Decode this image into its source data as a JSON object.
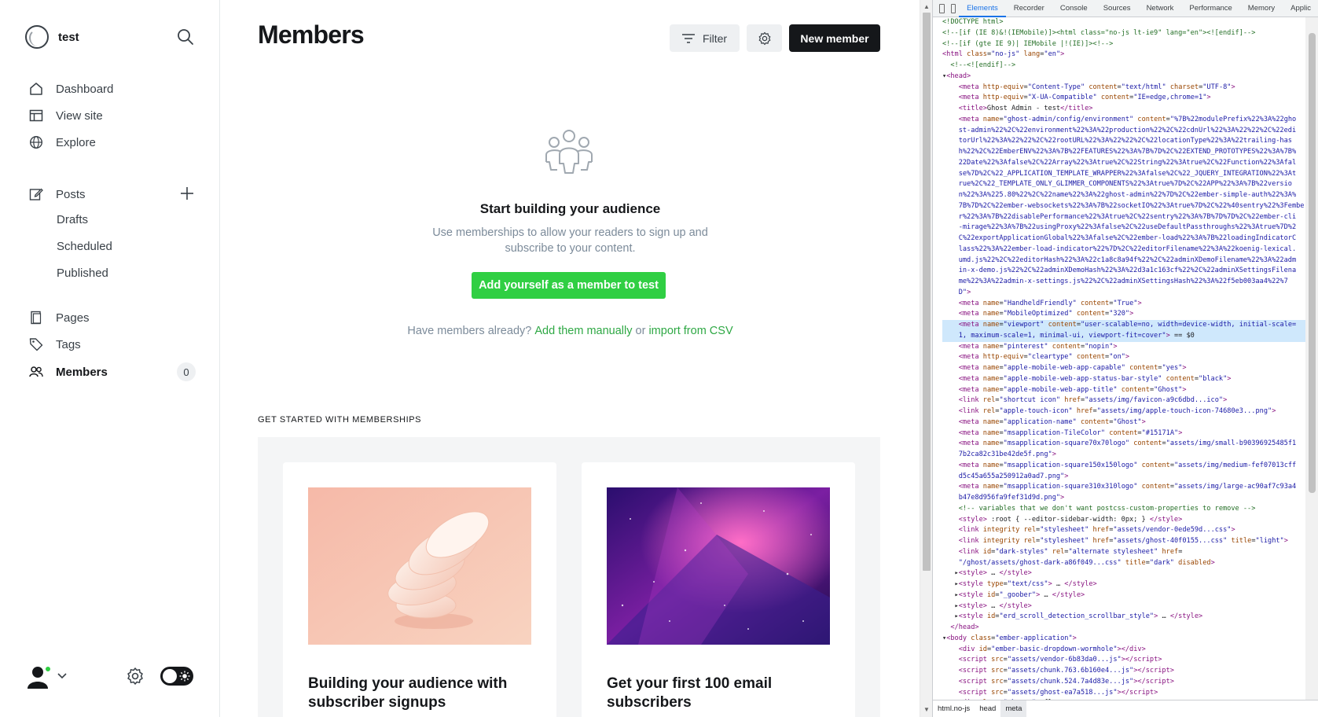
{
  "sidebar": {
    "site_title": "test",
    "nav": {
      "dashboard": "Dashboard",
      "view_site": "View site",
      "explore": "Explore",
      "posts": "Posts",
      "drafts": "Drafts",
      "scheduled": "Scheduled",
      "published": "Published",
      "pages": "Pages",
      "tags": "Tags",
      "members": "Members",
      "members_count": "0"
    }
  },
  "main": {
    "title": "Members",
    "filter_label": "Filter",
    "new_member_label": "New member",
    "empty_title": "Start building your audience",
    "empty_desc": "Use memberships to allow your readers to sign up and subscribe to your content.",
    "add_self_label": "Add yourself as a member to test",
    "have_members_prefix": "Have members already?",
    "add_manually": "Add them manually",
    "or_text": "or",
    "import_csv": "import from CSV",
    "section_label": "GET STARTED WITH MEMBERSHIPS",
    "cards": [
      {
        "title": "Building your audience with subscriber signups"
      },
      {
        "title": "Get your first 100 email subscribers"
      }
    ]
  },
  "devtools": {
    "tabs": [
      "Elements",
      "Recorder",
      "Console",
      "Sources",
      "Network",
      "Performance",
      "Memory",
      "Applic"
    ],
    "active_tab": "Elements",
    "crumbs": [
      "html.no-js",
      "head",
      "meta"
    ],
    "colors": {
      "accent": "#1a73e8",
      "tag": "#881280",
      "attr_name": "#994500",
      "attr_value": "#1a1aa6"
    }
  },
  "colors": {
    "brand_green": "#30cf43",
    "dark": "#15171a",
    "muted": "#7c8b9a"
  }
}
